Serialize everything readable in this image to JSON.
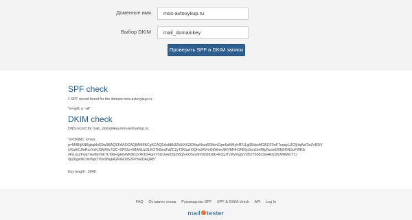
{
  "form": {
    "domain_label": "Доменное имя",
    "domain_value": "mos-avtovykup.ru",
    "dkim_label": "Выбор DKIM",
    "dkim_value": "mail_domainkey",
    "submit_label": "Проверить SPF и DKIM записи"
  },
  "spf": {
    "title": "SPF check",
    "found_text": "1 SPF record found for the domain mos-avtovykup.ru :",
    "record": "\"v=spf1 a ~all\""
  },
  "dkim": {
    "title": "DKIM check",
    "found_text": "DNS record for mail._domainkey.mos-avtovykup.ru:",
    "record_line1": "\"v=DKIM1; k=rsa;",
    "record_line2": "p=MIIBIjANBgkqhkiG9w0BAQEFAAOCAQ8AMIIBCgKCAQEAzbBk3Zb5tXKZiD8qzNoar5R8ehCqm6aNMyk4FULgiD5dwMGBC9TwF7eqayUJCfjHqAaITwZvRDV",
    "record_line3": "UXa/kCJfeRzsYzKJSM/6lv7t2C+XF62z+IMANLb/2LKOTk8snjFdZC2yT3Klazh0QHx34VmGkWmn/jMVMHH1FE6pSxufJmfBlpNzowD0fjGf6NSuFWE3r",
    "record_line4": "/4n1ncZFwqTGv8EV6kTC9Rj+lgEGWK8ilxZOR16I4qmY5UUoIeD5p5BqN+lO5sv/8V00U8x8b+R3qJTvMVKqjSV/8577658s3w4A3c0fcMNMmTTJ",
    "record_line5": "/tpZ6gwNCmr/NpDTNv9NqkA2RI4O9S2FP5wIDAQAB\"",
    "key_length": "Key length : 2048"
  },
  "footer": {
    "links": [
      "FAQ",
      "Оставить отзыв",
      "Руководство SPF",
      "SPF & DKIM check",
      "API",
      "Log In"
    ],
    "logo_left": "mail",
    "logo_right": "tester"
  }
}
